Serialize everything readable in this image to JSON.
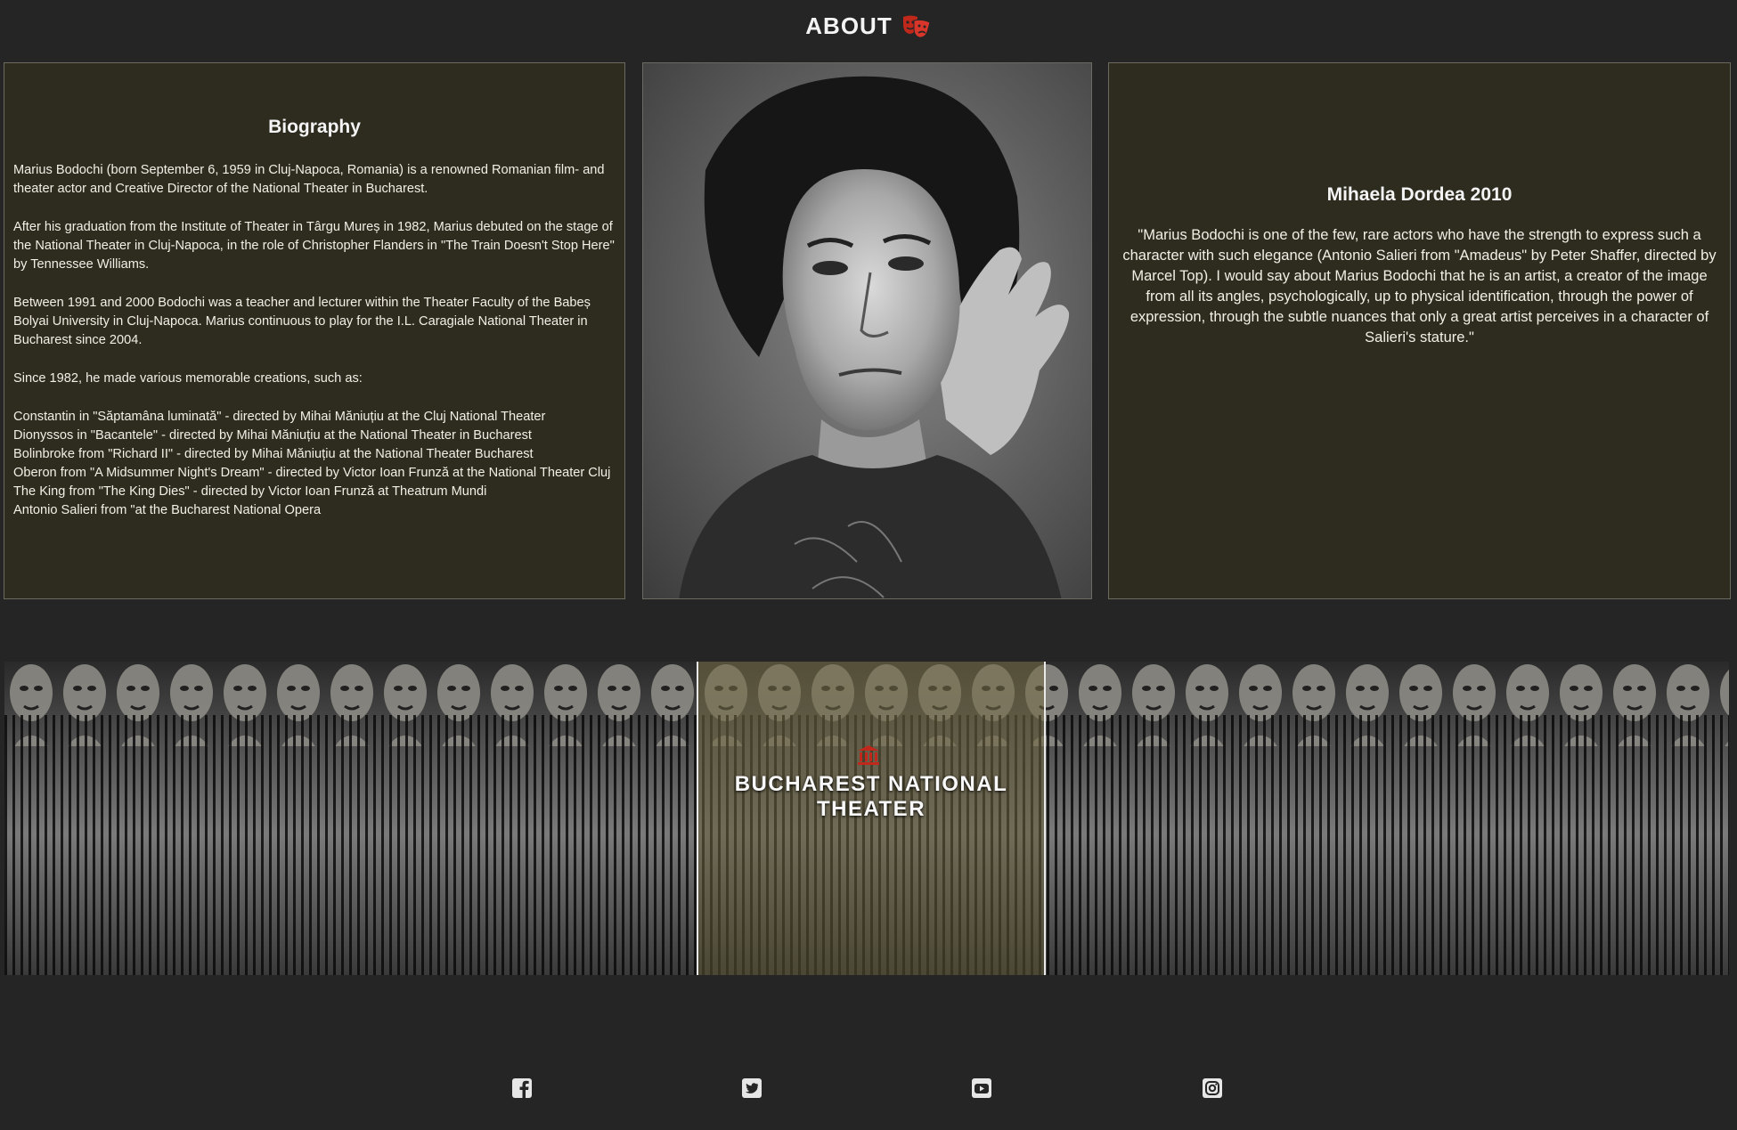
{
  "header": {
    "title": "ABOUT",
    "icon": "theater-masks-icon"
  },
  "biography": {
    "title": "Biography",
    "paragraphs": [
      "Marius Bodochi (born September 6, 1959 in Cluj-Napoca, Romania) is a renowned Romanian film- and theater actor and Creative Director of the National Theater in Bucharest.",
      "After his graduation from the Institute of Theater in Târgu Mureș in 1982, Marius debuted on the stage of the National Theater in Cluj-Napoca, in the role of Christopher Flanders in \"The Train Doesn't Stop Here\" by Tennessee Williams.",
      "Between 1991 and 2000 Bodochi was a teacher and lecturer within the Theater Faculty of the Babeș Bolyai University in Cluj-Napoca. Marius continuous to play for the I.L. Caragiale National Theater in Bucharest since 2004.",
      "Since 1982, he made various memorable creations, such as:"
    ],
    "roles": [
      "Constantin in \"Săptamâna luminată\" - directed by Mihai Măniuțiu at the Cluj National Theater",
      "Dionyssos in \"Bacantele\" - directed by Mihai Măniuțiu at the National Theater in Bucharest",
      "Bolinbroke from \"Richard II\" - directed by Mihai Măniuțiu at the National Theater Bucharest",
      "Oberon from \"A Midsummer Night's Dream\" - directed by Victor Ioan Frunză at the National Theater Cluj",
      "The King from \"The King Dies\" - directed by Victor Ioan Frunză at Theatrum Mundi",
      "Antonio Salieri from \"at the Bucharest National Opera"
    ]
  },
  "quote": {
    "title": "Mihaela Dordea 2010",
    "text": "\"Marius Bodochi is one of the few, rare actors who have the strength to express such a character with such elegance (Antonio Salieri from \"Amadeus\" by Peter Shaffer, directed by Marcel Top). I would say about Marius Bodochi that he is an artist, a creator of the image from all its angles, psychologically, up to physical identification, through the power of expression, through the subtle nuances that only a great artist perceives in a character of Salieri's stature.\""
  },
  "banner": {
    "title": "BUCHAREST NATIONAL THEATER",
    "icon": "landmark-icon"
  },
  "social": [
    "facebook-icon",
    "twitter-icon",
    "youtube-icon",
    "instagram-icon"
  ],
  "colors": {
    "accent": "#c0281c",
    "card_bg": "#2e2b1f",
    "page_bg": "#252525"
  }
}
